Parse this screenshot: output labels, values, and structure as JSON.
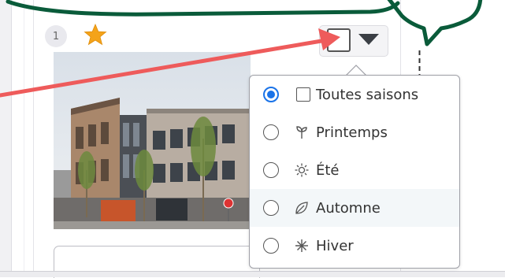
{
  "card": {
    "rank": "1"
  },
  "season_menu": {
    "items": [
      {
        "label": "Toutes saisons",
        "icon": "square-outline-icon",
        "selected": true
      },
      {
        "label": "Printemps",
        "icon": "sprout-icon",
        "selected": false
      },
      {
        "label": "Été",
        "icon": "sun-icon",
        "selected": false
      },
      {
        "label": "Automne",
        "icon": "leaf-icon",
        "selected": false
      },
      {
        "label": "Hiver",
        "icon": "snowflake-icon",
        "selected": false
      }
    ]
  },
  "colors": {
    "annotation_green": "#0a5b3a",
    "annotation_arrow": "#ee5b5b",
    "radio_selected": "#1a73e8",
    "star": "#f4a31a"
  }
}
